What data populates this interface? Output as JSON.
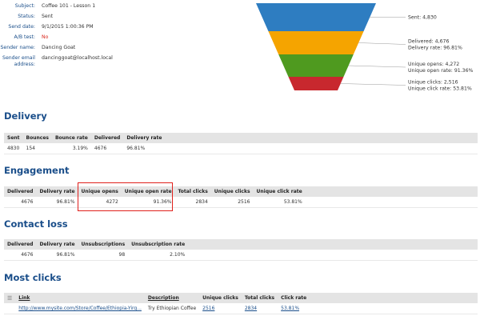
{
  "properties": [
    {
      "label": "Subject:",
      "value": "Coffee 101 - Lesson 1"
    },
    {
      "label": "Status:",
      "value": "Sent"
    },
    {
      "label": "Send date:",
      "value": "9/1/2015 1:00:36 PM"
    },
    {
      "label": "A/B test:",
      "value": "No",
      "color": "#d9261c"
    },
    {
      "label": "Sender name:",
      "value": "Dancing Goat"
    },
    {
      "label": "Sender email address:",
      "value": "dancinggoat@localhost.local"
    }
  ],
  "funnel": {
    "stages": [
      {
        "lines": [
          "Sent: 4,830"
        ],
        "value": 4830,
        "color": "#2e7dc1"
      },
      {
        "lines": [
          "Delivered: 4,676",
          "Delivery rate: 96.81%"
        ],
        "value": 4676,
        "color": "#f5a400"
      },
      {
        "lines": [
          "Unique opens: 4,272",
          "Unique open rate: 91.36%"
        ],
        "value": 4272,
        "color": "#4f9a1f"
      },
      {
        "lines": [
          "Unique clicks: 2,516",
          "Unique click rate: 53.81%"
        ],
        "value": 2516,
        "color": "#c8282e"
      }
    ]
  },
  "delivery": {
    "title": "Delivery",
    "headers": [
      "Sent",
      "Bounces",
      "Bounce rate",
      "Delivered",
      "Delivery rate"
    ],
    "row": [
      "4830",
      "154",
      "3.19%",
      "4676",
      "96.81%"
    ]
  },
  "engagement": {
    "title": "Engagement",
    "headers": [
      "Delivered",
      "Delivery rate",
      "Unique opens",
      "Unique open rate",
      "Total clicks",
      "Unique clicks",
      "Unique click rate"
    ],
    "row": [
      "4676",
      "96.81%",
      "4272",
      "91.36%",
      "2834",
      "2516",
      "53.81%"
    ]
  },
  "contact_loss": {
    "title": "Contact loss",
    "headers": [
      "Delivered",
      "Delivery rate",
      "Unsubscriptions",
      "Unsubscription rate"
    ],
    "row": [
      "4676",
      "96.81%",
      "98",
      "2.10%"
    ]
  },
  "most_clicks": {
    "title": "Most clicks",
    "menu_icon": "menu-icon",
    "headers": [
      "Link",
      "Description",
      "Unique clicks",
      "Total clicks",
      "Click rate"
    ],
    "row": [
      "http://www.mysite.com/Store/Coffee/Ethiopia-Yirg...",
      "Try Ethiopian Coffee",
      "2516",
      "2834",
      "53.81%"
    ]
  }
}
